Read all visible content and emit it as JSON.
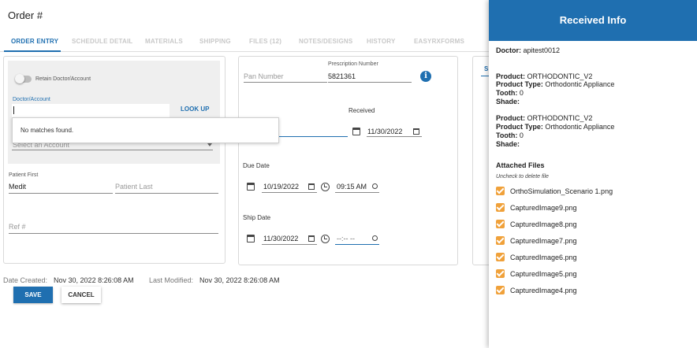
{
  "header": {
    "title": "Order #"
  },
  "tabs": [
    {
      "label": "ORDER ENTRY"
    },
    {
      "label": "SCHEDULE DETAIL"
    },
    {
      "label": "MATERIALS"
    },
    {
      "label": "SHIPPING"
    },
    {
      "label": "FILES (12)"
    },
    {
      "label": "NOTES/DESIGNS"
    },
    {
      "label": "HISTORY"
    },
    {
      "label": "EASYRXFORMS"
    }
  ],
  "doctor_card": {
    "retain_label": "Retain Doctor/Account",
    "doctor_label": "Doctor/Account",
    "doctor_value": "",
    "lookup": "LOOK UP",
    "no_matches": "No matches found.",
    "account_placeholder": "Select an Account",
    "patient_first_label": "Patient First",
    "patient_first_value": "Medit",
    "patient_last_placeholder": "Patient Last",
    "ref_placeholder": "Ref #"
  },
  "dates_card": {
    "pan_placeholder": "Pan Number",
    "rx_label": "Prescription Number",
    "rx_value": "5821361",
    "info_glyph": "i",
    "received_label": "Received",
    "received_date": "11/30/2022",
    "due_label": "Due Date",
    "due_date": "10/19/2022",
    "due_time": "09:15 AM",
    "ship_label": "Ship Date",
    "ship_date": "11/30/2022",
    "ship_time": "--:-- --"
  },
  "third_card": {
    "tab_partial": "S"
  },
  "meta": {
    "created_label": "Date Created:",
    "created_value": "Nov 30, 2022 8:26:08 AM",
    "modified_label": "Last Modified:",
    "modified_value": "Nov 30, 2022 8:26:08 AM"
  },
  "buttons": {
    "save": "SAVE",
    "cancel": "CANCEL"
  },
  "panel": {
    "title": "Received Info",
    "doctor_label": "Doctor:",
    "doctor_value": "apitest0012",
    "products": [
      {
        "product_label": "Product:",
        "product": "ORTHODONTIC_V2",
        "type_label": "Product Type:",
        "type": "Orthodontic Appliance",
        "tooth_label": "Tooth:",
        "tooth": "0",
        "shade_label": "Shade:",
        "shade": ""
      },
      {
        "product_label": "Product:",
        "product": "ORTHODONTIC_V2",
        "type_label": "Product Type:",
        "type": "Orthodontic Appliance",
        "tooth_label": "Tooth:",
        "tooth": "0",
        "shade_label": "Shade:",
        "shade": ""
      }
    ],
    "attached_title": "Attached Files",
    "attached_hint": "Uncheck to delete file",
    "files": [
      {
        "name": "OrthoSimulation_Scenario 1.png",
        "checked": true
      },
      {
        "name": "CapturedImage9.png",
        "checked": true
      },
      {
        "name": "CapturedImage8.png",
        "checked": true
      },
      {
        "name": "CapturedImage7.png",
        "checked": true
      },
      {
        "name": "CapturedImage6.png",
        "checked": true
      },
      {
        "name": "CapturedImage5.png",
        "checked": true
      },
      {
        "name": "CapturedImage4.png",
        "checked": true
      }
    ]
  },
  "colors": {
    "accent": "#1f6fb0",
    "checkbox": "#f0a13a"
  }
}
